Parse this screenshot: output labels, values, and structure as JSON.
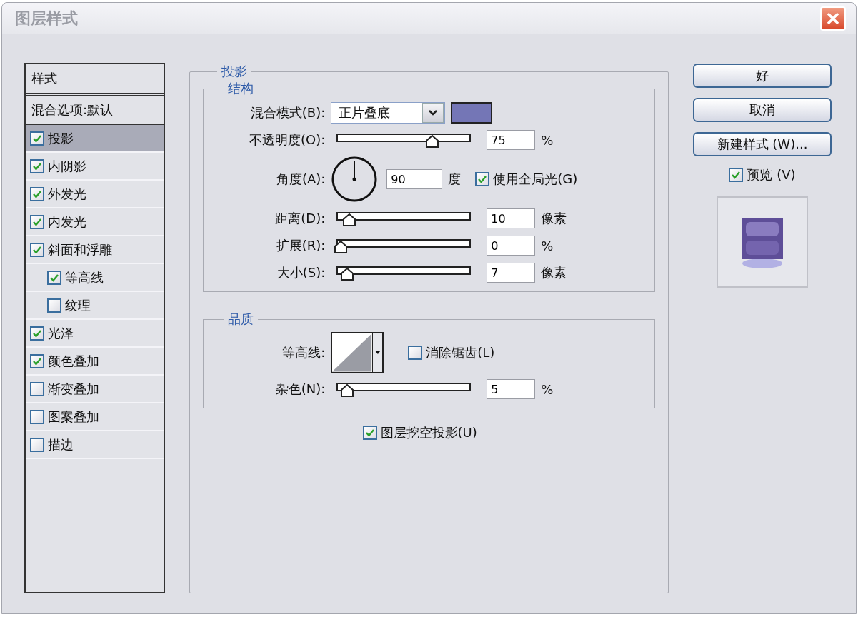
{
  "window": {
    "title": "图层样式"
  },
  "styles": {
    "header": "样式",
    "blending_options": "混合选项:默认",
    "items": [
      {
        "label": "投影",
        "checked": true,
        "selected": true
      },
      {
        "label": "内阴影",
        "checked": true,
        "selected": false
      },
      {
        "label": "外发光",
        "checked": true,
        "selected": false
      },
      {
        "label": "内发光",
        "checked": true,
        "selected": false
      },
      {
        "label": "斜面和浮雕",
        "checked": true,
        "selected": false,
        "children": [
          {
            "label": "等高线",
            "checked": true,
            "selected": false
          },
          {
            "label": "纹理",
            "checked": false,
            "selected": false
          }
        ]
      },
      {
        "label": "光泽",
        "checked": true,
        "selected": false
      },
      {
        "label": "颜色叠加",
        "checked": true,
        "selected": false
      },
      {
        "label": "渐变叠加",
        "checked": false,
        "selected": false
      },
      {
        "label": "图案叠加",
        "checked": false,
        "selected": false
      },
      {
        "label": "描边",
        "checked": false,
        "selected": false
      }
    ]
  },
  "panel": {
    "title": "投影",
    "structure": {
      "title": "结构",
      "rows": [
        {
          "kind": "select",
          "label": "混合模式(B):",
          "value": "正片叠底",
          "color": "#7476b6"
        },
        {
          "kind": "slider",
          "label": "不透明度(O):",
          "level": 0.74,
          "value": "75",
          "unit": "%"
        },
        {
          "kind": "angle",
          "label": "角度(A):",
          "value": "90",
          "unit": "度",
          "global_light": {
            "label": "使用全局光(G)",
            "checked": true
          }
        },
        {
          "kind": "slider",
          "label": "距离(D):",
          "level": 0.07,
          "value": "10",
          "unit": "像素"
        },
        {
          "kind": "slider",
          "label": "扩展(R):",
          "level": 0,
          "value": "0",
          "unit": "%"
        },
        {
          "kind": "slider",
          "label": "大小(S):",
          "level": 0.05,
          "value": "7",
          "unit": "像素"
        }
      ]
    },
    "quality": {
      "title": "品质",
      "rows": [
        {
          "kind": "contour",
          "label": "等高线:",
          "anti_alias": {
            "label": "消除锯齿(L)",
            "checked": false
          }
        },
        {
          "kind": "slider",
          "label": "杂色(N):",
          "level": 0.05,
          "value": "5",
          "unit": "%"
        }
      ]
    },
    "knockout": {
      "label": "图层挖空投影(U)",
      "checked": true
    }
  },
  "buttons": [
    "好",
    "取消",
    "新建样式 (W)..."
  ],
  "preview": {
    "label": "预览 (V)",
    "checked": true
  }
}
